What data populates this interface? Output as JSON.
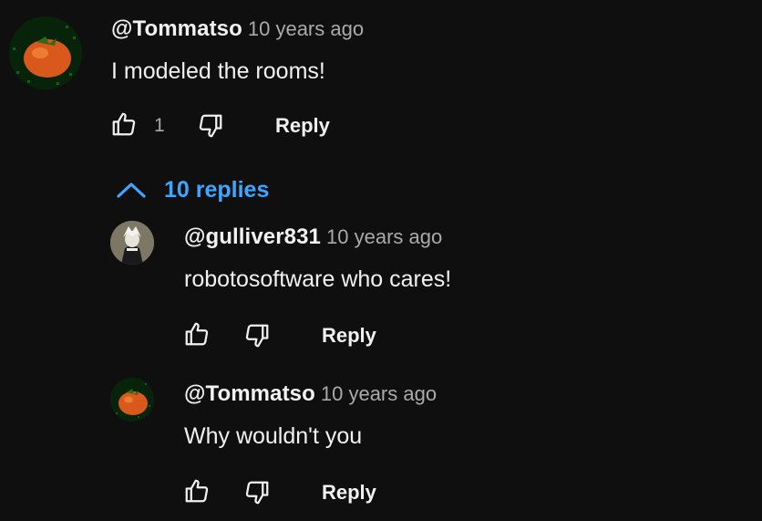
{
  "comments": [
    {
      "author": "@Tommatso",
      "time": "10 years ago",
      "text": "I modeled the rooms!",
      "likes": "1",
      "reply_label": "Reply",
      "avatar": "tomato-avatar"
    }
  ],
  "replies_toggle": {
    "label": "10 replies",
    "icon": "chevron-up-icon",
    "color": "#3ea6ff"
  },
  "replies": [
    {
      "author": "@gulliver831",
      "time": "10 years ago",
      "text": "robotosoftware who cares!",
      "reply_label": "Reply",
      "avatar": "character-avatar"
    },
    {
      "author": "@Tommatso",
      "time": "10 years ago",
      "text": "Why wouldn't you",
      "reply_label": "Reply",
      "avatar": "tomato-avatar"
    }
  ],
  "colors": {
    "background": "#0f0f0f",
    "text": "#f1f1f1",
    "secondary": "#aaaaaa",
    "link": "#3ea6ff"
  }
}
